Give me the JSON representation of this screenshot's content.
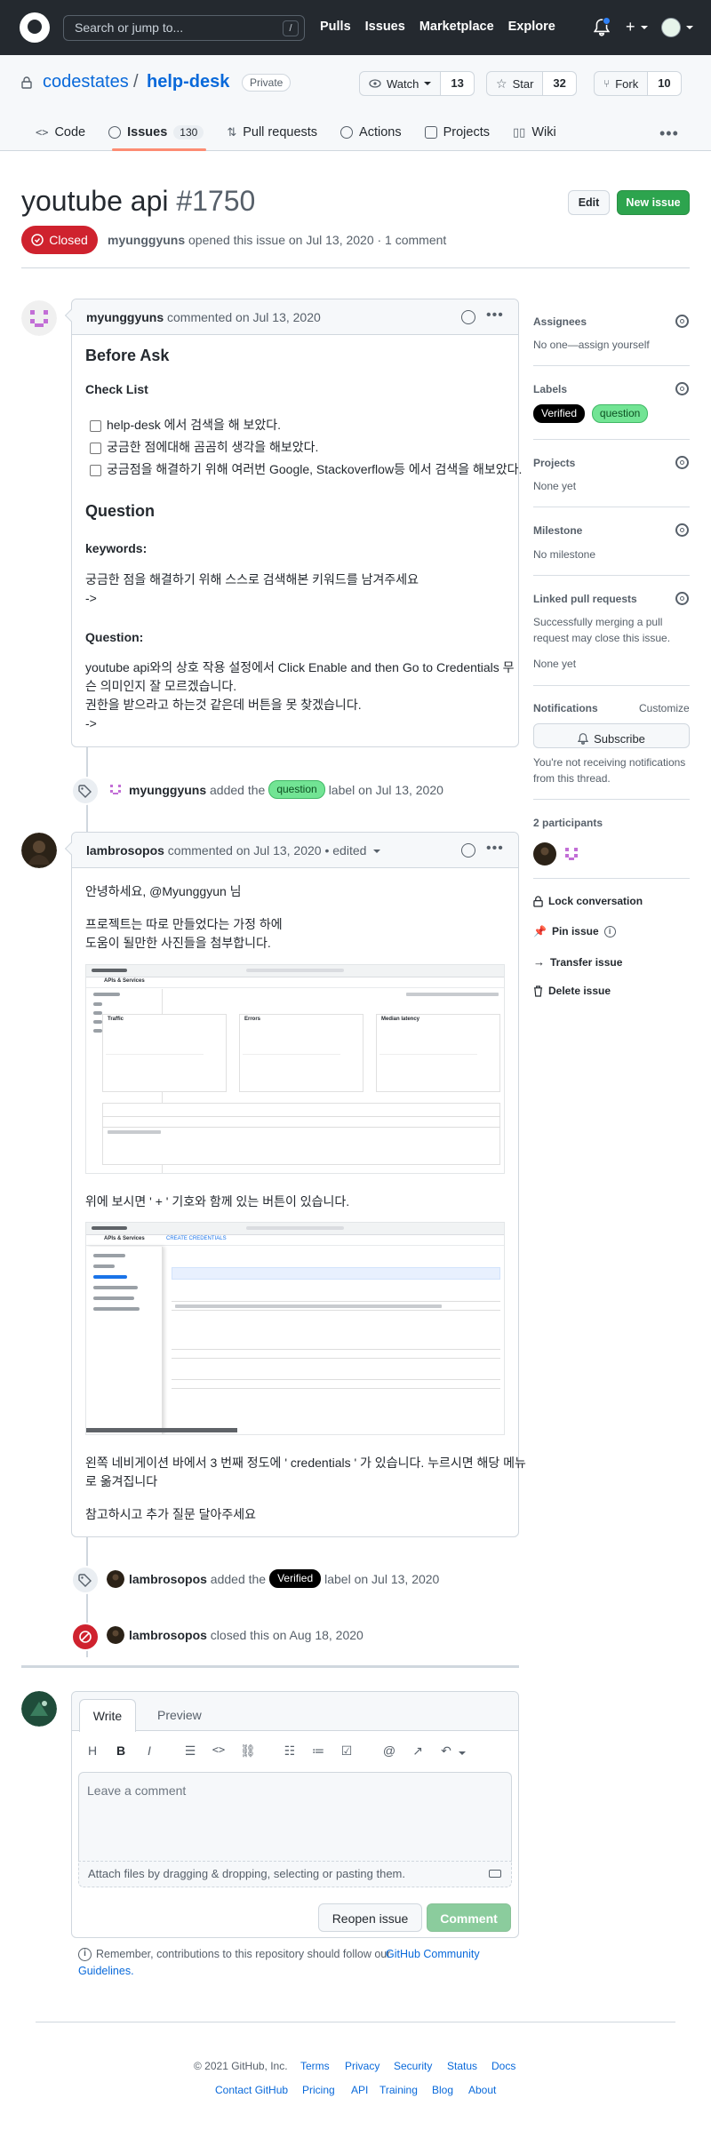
{
  "header": {
    "search_placeholder": "Search or jump to...",
    "slash_key": "/",
    "nav": [
      "Pulls",
      "Issues",
      "Marketplace",
      "Explore"
    ]
  },
  "repo": {
    "owner": "codestates",
    "separator": "/",
    "name": "help-desk",
    "visibility": "Private",
    "watch_label": "Watch",
    "watch_count": "13",
    "star_label": "Star",
    "star_count": "32",
    "fork_label": "Fork",
    "fork_count": "10",
    "tabs": [
      {
        "label": "Code"
      },
      {
        "label": "Issues",
        "count": "130"
      },
      {
        "label": "Pull requests"
      },
      {
        "label": "Actions"
      },
      {
        "label": "Projects"
      },
      {
        "label": "Wiki"
      }
    ]
  },
  "issue": {
    "title": "youtube api",
    "number": "#1750",
    "edit_label": "Edit",
    "new_issue_label": "New issue",
    "state": "Closed",
    "author": "myunggyuns",
    "opened_text": "opened this issue on Jul 13, 2020 · 1 comment"
  },
  "comment1": {
    "author": "myunggyuns",
    "meta": "commented on Jul 13, 2020",
    "h_before": "Before Ask",
    "h_checklist": "Check List",
    "checks": [
      "help-desk 에서 검색을 해 보았다.",
      "궁금한 점에대해 곰곰히 생각을 해보았다.",
      "궁금점을 해결하기 위해 여러번 Google, Stackoverflow등 에서 검색을 해보았다."
    ],
    "h_question": "Question",
    "kw_label": "keywords:",
    "kw_text": "궁금한 점을 해결하기 위해 스스로 검색해본 키워드를 남겨주세요",
    "kw_arrow": "->",
    "q_label": "Question:",
    "q_line1": "youtube api와의 상호 작용 설정에서 Click Enable and then Go to Credentials 무",
    "q_line2": "슨 의미인지 잘 모르겠습니다.",
    "q_line3": "권한을 받으라고 하는것 같은데 버튼을 못 찾겠습니다.",
    "q_arrow": "->"
  },
  "event1": {
    "actor": "myunggyuns",
    "pre": "added the",
    "label": "question",
    "post": "label on Jul 13, 2020"
  },
  "comment2": {
    "author": "lambrosopos",
    "meta": "commented on Jul 13, 2020 • edited",
    "greeting": "안녕하세요, @Myunggyun 님",
    "p1_line1": "프로젝트는 따로 만들었다는 가정 하에",
    "p1_line2": "도움이 될만한 사진들을 첨부합니다.",
    "shot1": {
      "tabs": [
        "Traffic",
        "Errors",
        "Median latency"
      ],
      "title": "APIs & Services"
    },
    "p2": "위에 보시면 ' + ' 기호와 함께 있는 버튼이 있습니다.",
    "shot2": {
      "title": "APIs & Services",
      "top_btn": "CREATE CREDENTIALS"
    },
    "p3_line1": "왼쪽 네비게이션 바에서 3 번째 정도에 ' credentials ' 가 있습니다. 누르시면 해당 메뉴",
    "p3_line2": "로 옮겨집니다",
    "p4": "참고하시고 추가 질문 달아주세요"
  },
  "event2": {
    "actor": "lambrosopos",
    "pre": "added the",
    "label": "Verified",
    "post": "label on Jul 13, 2020"
  },
  "event3": {
    "actor": "lambrosopos",
    "text": "closed this on Aug 18, 2020"
  },
  "new_comment": {
    "tab_write": "Write",
    "tab_preview": "Preview",
    "placeholder": "Leave a comment",
    "attach_hint": "Attach files by dragging & dropping, selecting or pasting them.",
    "reopen_label": "Reopen issue",
    "comment_label": "Comment",
    "notice_pre": "Remember, contributions to this repository should follow our",
    "notice_link1": "GitHub Community",
    "notice_link2": "Guidelines."
  },
  "sidebar": {
    "assignees_title": "Assignees",
    "assignees_text": "No one—assign yourself",
    "labels_title": "Labels",
    "labels": [
      "Verified",
      "question"
    ],
    "projects_title": "Projects",
    "projects_text": "None yet",
    "milestone_title": "Milestone",
    "milestone_text": "No milestone",
    "linked_title": "Linked pull requests",
    "linked_text1": "Successfully merging a pull",
    "linked_text2": "request may close this issue.",
    "linked_text3": "None yet",
    "notifications_title": "Notifications",
    "customize": "Customize",
    "subscribe_label": "Subscribe",
    "notif_text1": "You're not receiving notifications",
    "notif_text2": "from this thread.",
    "participants_title": "2 participants",
    "lock": "Lock conversation",
    "pin": "Pin issue",
    "transfer": "Transfer issue",
    "delete": "Delete issue"
  },
  "footer": {
    "copyright": "© 2021 GitHub, Inc.",
    "row1": [
      "Terms",
      "Privacy",
      "Security",
      "Status",
      "Docs"
    ],
    "row2": [
      "Contact GitHub",
      "Pricing",
      "API",
      "Training",
      "Blog",
      "About"
    ]
  },
  "colors": {
    "header_bg": "#24292f",
    "closed_red": "#cf222e",
    "green": "#2da44e",
    "link": "#0969da",
    "label_question": "#72e494",
    "label_verified": "#000000"
  }
}
